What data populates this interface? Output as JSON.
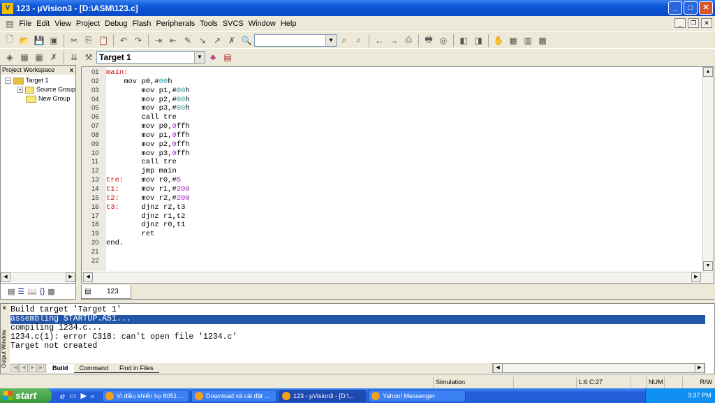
{
  "window": {
    "title": "123  - µVision3 - [D:\\ASM\\123.c]",
    "minimize": "_",
    "maximize": "□",
    "close": "✕"
  },
  "menu": [
    "File",
    "Edit",
    "View",
    "Project",
    "Debug",
    "Flash",
    "Peripherals",
    "Tools",
    "SVCS",
    "Window",
    "Help"
  ],
  "toolbar": {
    "find_value": "",
    "target_value": "Target 1"
  },
  "workspace": {
    "title": "Project Workspace",
    "close": "x",
    "tree": [
      "Target 1",
      "Source Group",
      "New Group"
    ]
  },
  "editor": {
    "tab": "123",
    "lines": [
      {
        "n": "01",
        "s": [
          [
            "lab",
            "main:"
          ]
        ]
      },
      {
        "n": "02",
        "s": [
          [
            "",
            "    mov p0,#"
          ],
          [
            "nt",
            "00"
          ],
          [
            "",
            "h"
          ]
        ]
      },
      {
        "n": "03",
        "s": [
          [
            "",
            "        mov p1,#"
          ],
          [
            "nt",
            "00"
          ],
          [
            "",
            "h"
          ]
        ]
      },
      {
        "n": "04",
        "s": [
          [
            "",
            "        mov p2,#"
          ],
          [
            "nt",
            "00"
          ],
          [
            "",
            "h"
          ]
        ]
      },
      {
        "n": "05",
        "s": [
          [
            "",
            "        mov p3,#"
          ],
          [
            "nt",
            "00"
          ],
          [
            "",
            "h"
          ]
        ]
      },
      {
        "n": "06",
        "s": [
          [
            "",
            "        call tre"
          ]
        ]
      },
      {
        "n": "07",
        "s": [
          [
            "",
            "        mov p0,"
          ],
          [
            "np",
            "0"
          ],
          [
            "",
            "ffh"
          ]
        ]
      },
      {
        "n": "08",
        "s": [
          [
            "",
            "        mov p1,"
          ],
          [
            "np",
            "0"
          ],
          [
            "",
            "ffh"
          ]
        ]
      },
      {
        "n": "09",
        "s": [
          [
            "",
            "        mov p2,"
          ],
          [
            "np",
            "0"
          ],
          [
            "",
            "ffh"
          ]
        ]
      },
      {
        "n": "10",
        "s": [
          [
            "",
            "        mov p3,"
          ],
          [
            "np",
            "0"
          ],
          [
            "",
            "ffh"
          ]
        ]
      },
      {
        "n": "11",
        "s": [
          [
            "",
            "        call tre"
          ]
        ]
      },
      {
        "n": "12",
        "s": [
          [
            "",
            "        jmp main"
          ]
        ]
      },
      {
        "n": "13",
        "s": [
          [
            "lab",
            "tre:"
          ],
          [
            "",
            "    mov r0,#"
          ],
          [
            "np",
            "5"
          ]
        ]
      },
      {
        "n": "14",
        "s": [
          [
            "lab",
            "t1:"
          ],
          [
            "",
            "     mov r1,#"
          ],
          [
            "np",
            "200"
          ]
        ]
      },
      {
        "n": "15",
        "s": [
          [
            "lab",
            "t2:"
          ],
          [
            "",
            "     mov r2,#"
          ],
          [
            "np",
            "200"
          ]
        ]
      },
      {
        "n": "16",
        "s": [
          [
            "lab",
            "t3:"
          ],
          [
            "",
            "     djnz r2,t3"
          ]
        ]
      },
      {
        "n": "17",
        "s": [
          [
            "",
            "        djnz r1,t2"
          ]
        ]
      },
      {
        "n": "18",
        "s": [
          [
            "",
            "        djnz r0,t1"
          ]
        ]
      },
      {
        "n": "19",
        "s": [
          [
            "",
            "        ret"
          ]
        ]
      },
      {
        "n": "20",
        "s": [
          [
            "",
            "end."
          ]
        ]
      },
      {
        "n": "21",
        "s": []
      },
      {
        "n": "22",
        "s": []
      }
    ]
  },
  "output": {
    "title": "Output Window",
    "lines": [
      "Build target 'Target 1'",
      "assembling STARTUP.A51...",
      "compiling 1234.c...",
      "1234.c(1): error C318: can't open file '1234.c'",
      "Target not created"
    ],
    "selected_index": 1,
    "tabs": [
      "Build",
      "Command",
      "Find in Files"
    ]
  },
  "status": {
    "mode": "Simulation",
    "position": "L:6 C:27",
    "num": "NUM",
    "rw": "R/W"
  },
  "taskbar": {
    "start": "start",
    "items": [
      "Vi điều khiển họ 8051 ...",
      "Download và cài đặt ...",
      "123  - µVision3 - [D:\\...",
      "Yahoo! Messenger"
    ],
    "active_index": 2,
    "clock": "3:37 PM"
  },
  "colors": {
    "label": "#d00000",
    "hex_literal": "#20a0a0",
    "number": "#a020c0",
    "selection": "#2456a8"
  }
}
